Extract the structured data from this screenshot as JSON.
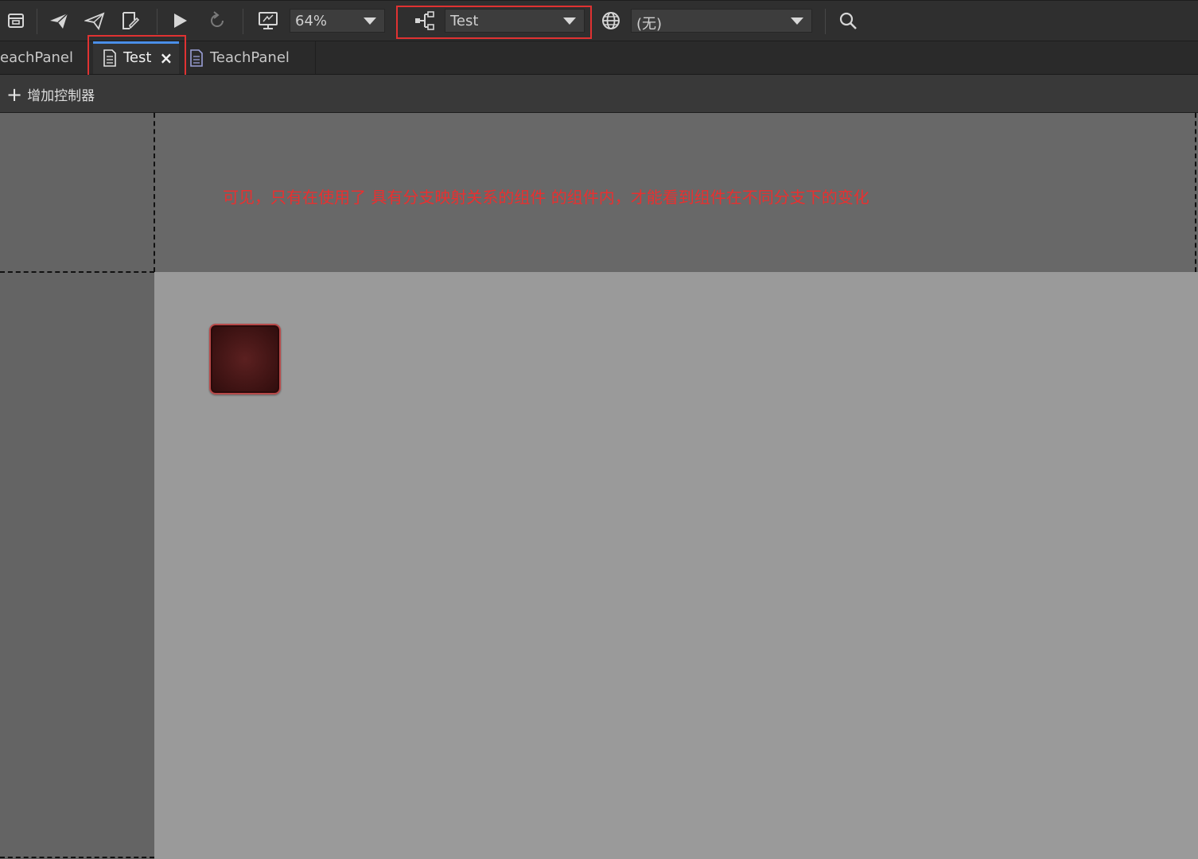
{
  "toolbar": {
    "zoom_value": "64%",
    "branch_value": "Test",
    "language_value": "(无)",
    "icons": [
      "package-icon",
      "publish-icon",
      "publish-outline-icon",
      "edit-document-icon",
      "play-icon",
      "refresh-icon",
      "monitor-icon",
      "branch-icon",
      "globe-icon",
      "search-icon"
    ]
  },
  "tabs": [
    {
      "label": "eachPanel",
      "active": false
    },
    {
      "label": "Test",
      "active": true,
      "close": "×"
    },
    {
      "label": "TeachPanel",
      "active": false
    }
  ],
  "controller_bar": {
    "add_icon": "+",
    "add_label": "增加控制器"
  },
  "canvas": {
    "annotation": "可见，只有在使用了 具有分支映射关系的组件 的组件内，才能看到组件在不同分支下的变化"
  },
  "colors": {
    "highlight": "#e03232",
    "annotation": "#e83030",
    "tab_accent": "#4a8fe8"
  }
}
